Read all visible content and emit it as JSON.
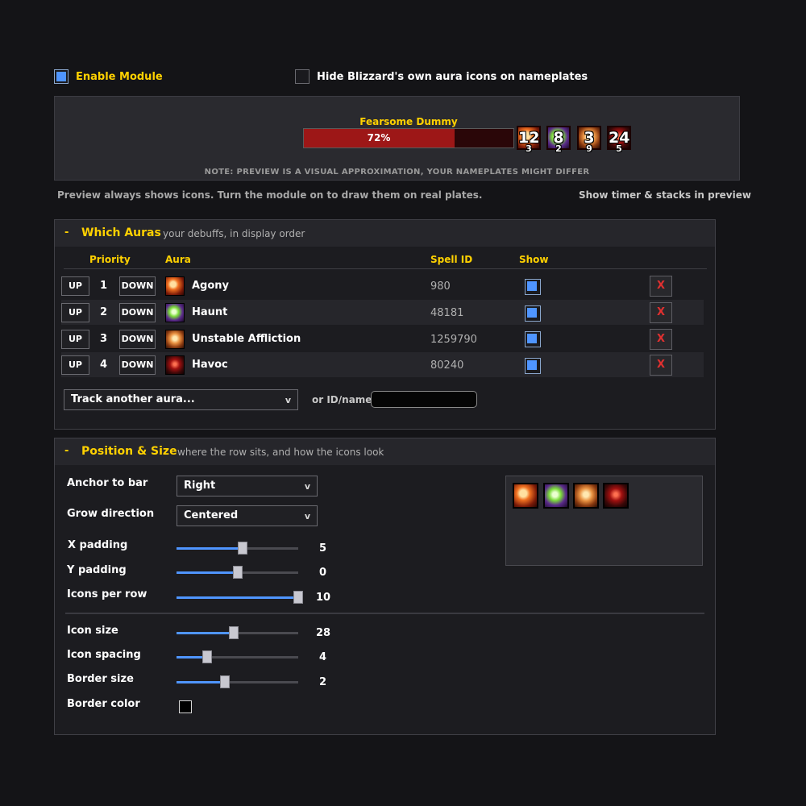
{
  "top": {
    "enable_module": {
      "label": "Enable Module",
      "checked": true
    },
    "hide_blizzard": {
      "label": "Hide Blizzard's own aura icons on nameplates",
      "checked": false
    }
  },
  "preview": {
    "unit_name": "Fearsome Dummy",
    "health_percent": 72,
    "health_text": "72%",
    "note": "NOTE: PREVIEW IS A VISUAL APPROXIMATION, YOUR NAMEPLATES MIGHT DIFFER",
    "auras": [
      {
        "icon": "agony-icon",
        "timer": "12",
        "stacks": "3"
      },
      {
        "icon": "haunt-icon",
        "timer": "8",
        "stacks": "2"
      },
      {
        "icon": "unstable-affliction-icon",
        "timer": "3",
        "stacks": "9"
      },
      {
        "icon": "havoc-icon",
        "timer": "24",
        "stacks": "5"
      }
    ],
    "hint_left": "Preview always shows icons. Turn the module on to draw them on real plates.",
    "hint_right": "Show timer & stacks in preview"
  },
  "which_auras": {
    "collapse": "-",
    "title": "Which Auras",
    "subtitle": "your debuffs, in display order",
    "headers": {
      "priority": "Priority",
      "aura": "Aura",
      "spell_id": "Spell ID",
      "show": "Show"
    },
    "up_label": "UP",
    "down_label": "DOWN",
    "remove_label": "X",
    "rows": [
      {
        "priority": "1",
        "name": "Agony",
        "spell_id": "980",
        "show": true,
        "icon": "agony-icon"
      },
      {
        "priority": "2",
        "name": "Haunt",
        "spell_id": "48181",
        "show": true,
        "icon": "haunt-icon"
      },
      {
        "priority": "3",
        "name": "Unstable Affliction",
        "spell_id": "1259790",
        "show": true,
        "icon": "unstable-affliction-icon"
      },
      {
        "priority": "4",
        "name": "Havoc",
        "spell_id": "80240",
        "show": true,
        "icon": "havoc-icon"
      }
    ],
    "track_dropdown": "Track another aura...",
    "or_label": "or ID/name:",
    "id_input_value": "",
    "dropdown_arrow": "v"
  },
  "position_size": {
    "collapse": "-",
    "title": "Position & Size",
    "subtitle": "where the row sits, and how the icons look",
    "anchor": {
      "label": "Anchor to bar",
      "value": "Right"
    },
    "grow": {
      "label": "Grow direction",
      "value": "Centered"
    },
    "sliders": [
      {
        "label": "X padding",
        "value": "5",
        "fraction": 0.54
      },
      {
        "label": "Y padding",
        "value": "0",
        "fraction": 0.5
      },
      {
        "label": "Icons per row",
        "value": "10",
        "fraction": 1.0
      },
      {
        "label": "Icon size",
        "value": "28",
        "fraction": 0.47
      },
      {
        "label": "Icon spacing",
        "value": "4",
        "fraction": 0.25
      },
      {
        "label": "Border size",
        "value": "2",
        "fraction": 0.4
      }
    ],
    "border_color": {
      "label": "Border color",
      "value": "#000000"
    },
    "preview_icons": [
      "agony-icon",
      "haunt-icon",
      "unstable-affliction-icon",
      "havoc-icon"
    ]
  },
  "colors": {
    "accent_gold": "#ffd100",
    "checkbox_blue": "#4f95ff",
    "health_red": "#9d1717",
    "remove_red": "#e03030"
  }
}
